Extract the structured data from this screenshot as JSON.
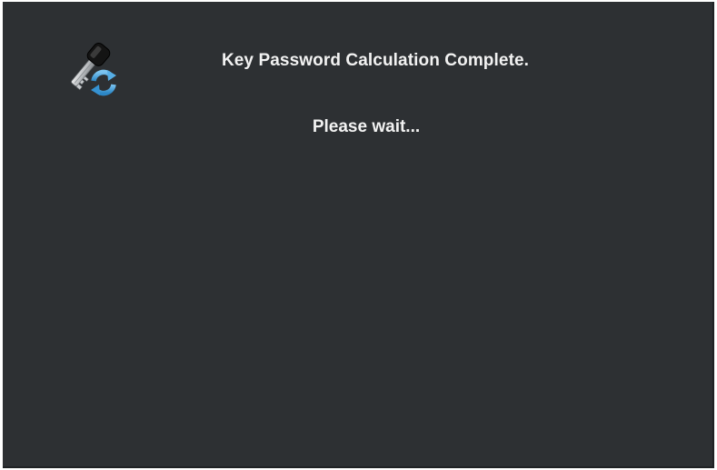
{
  "dialog": {
    "title": "Key Password Calculation Complete.",
    "message": "Please wait...",
    "icon": "key-refresh-icon"
  },
  "colors": {
    "background": "#2d3033",
    "text": "#f2f2f2",
    "refresh_arrows": "#4aa3df"
  }
}
